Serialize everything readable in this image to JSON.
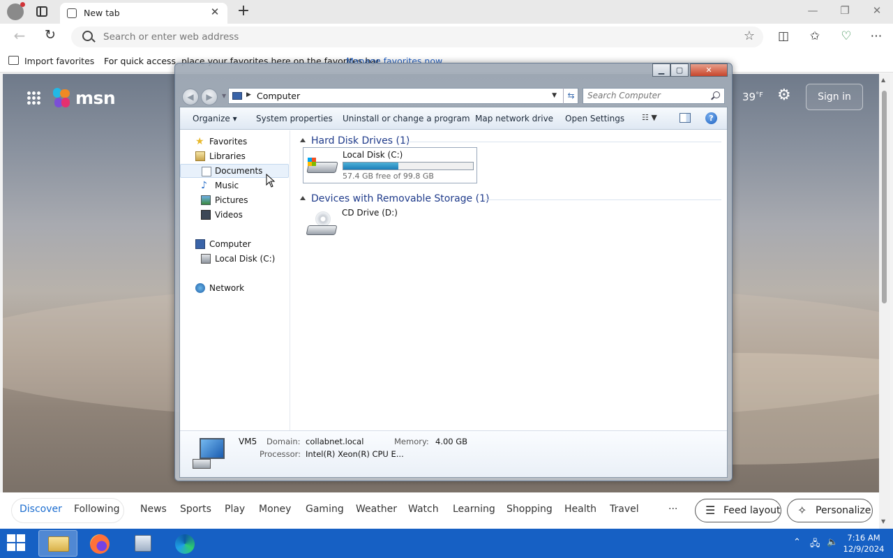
{
  "browser": {
    "tab_title": "New tab",
    "address_placeholder": "Search or enter web address",
    "favorites_bar": {
      "import_label": "Import favorites",
      "message": "For quick access, place your favorites here on the favorites bar.",
      "manage_link": "Manage favorites now"
    }
  },
  "msn": {
    "brand": "msn",
    "temperature": "39",
    "temperature_unit": "°F",
    "signin_label": "Sign in",
    "nav": {
      "discover": "Discover",
      "following": "Following",
      "items": [
        "News",
        "Sports",
        "Play",
        "Money",
        "Gaming",
        "Weather",
        "Watch",
        "Learning",
        "Shopping",
        "Health",
        "Travel"
      ],
      "more": "···",
      "feed_layout": "Feed layout",
      "personalize": "Personalize"
    }
  },
  "explorer": {
    "address_location": "Computer",
    "search_placeholder": "Search Computer",
    "toolbar": {
      "organize": "Organize ▾",
      "system_properties": "System properties",
      "uninstall": "Uninstall or change a program",
      "map_drive": "Map network drive",
      "open_settings": "Open Settings"
    },
    "nav": {
      "favorites": "Favorites",
      "libraries": "Libraries",
      "documents": "Documents",
      "music": "Music",
      "pictures": "Pictures",
      "videos": "Videos",
      "computer": "Computer",
      "local_disk": "Local Disk (C:)",
      "network": "Network"
    },
    "groups": {
      "hdd": "Hard Disk Drives (1)",
      "removable": "Devices with Removable Storage (1)"
    },
    "drives": {
      "c_name": "Local Disk (C:)",
      "c_free": "57.4 GB free of 99.8 GB",
      "c_used_fraction": 0.425,
      "d_name": "CD Drive (D:)"
    },
    "details": {
      "name": "VM5",
      "domain_label": "Domain:",
      "domain": "collabnet.local",
      "memory_label": "Memory:",
      "memory": "4.00 GB",
      "processor_label": "Processor:",
      "processor": "Intel(R) Xeon(R) CPU E..."
    }
  },
  "taskbar": {
    "time": "7:16 AM",
    "date": "12/9/2024"
  },
  "colors": {
    "taskbar": "#1660c4",
    "msn_active": "#1a6ccf",
    "explorer_group": "#1e3a8a"
  }
}
